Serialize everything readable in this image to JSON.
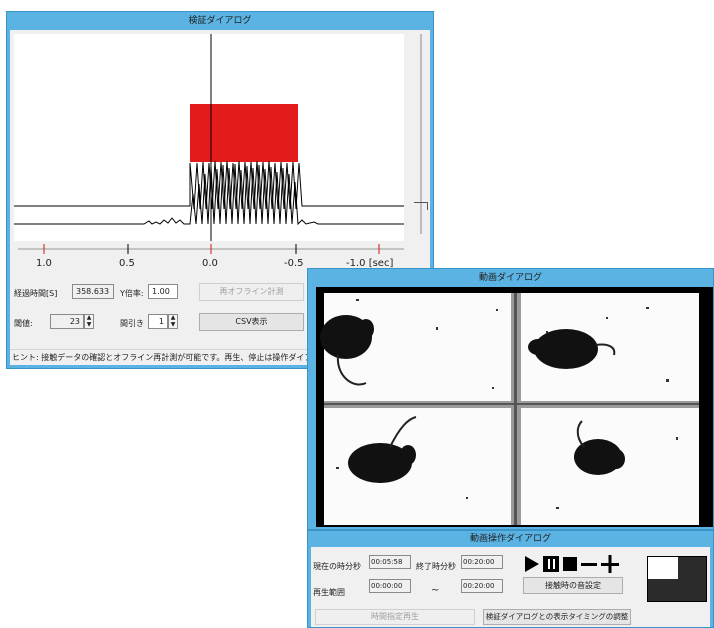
{
  "verify_dialog": {
    "title": "検証ダイアログ",
    "axis_ticks": [
      "1.0",
      "0.5",
      "0.0",
      "-0.5",
      "-1.0 [sec]"
    ],
    "elapsed_label": "経過時間[S]",
    "elapsed_value": "358.633",
    "ymag_label": "Y倍率:",
    "ymag_value": "1.00",
    "reoffline_button": "再オフライン計測",
    "threshold_label": "閾値:",
    "threshold_value": "23",
    "thinning_label": "間引き",
    "thinning_value": "1",
    "csv_button": "CSV表示",
    "hint": "ヒント:  接触データの確認とオフライン再計測が可能です。再生、停止は操作ダイアログか"
  },
  "video_dialog": {
    "title": "動画ダイアログ"
  },
  "operation_dialog": {
    "title": "動画操作ダイアログ",
    "current_time_label": "現在の時分秒",
    "current_time_value": "00:05:58",
    "end_time_label": "終了時分秒",
    "end_time_value": "00:20:00",
    "range_label": "再生範囲",
    "range_start": "00:00:00",
    "range_sep": "~",
    "range_end": "00:20:00",
    "touch_sound_button": "接触時の音設定",
    "time_play_button": "時間指定再生",
    "sync_button": "検証ダイアログとの表示タイミングの調整",
    "icons": [
      "play-icon",
      "pause-icon",
      "stop-icon",
      "minus-icon",
      "plus-icon"
    ]
  },
  "colors": {
    "titlebar": "#5ab3e3",
    "highlight": "#e31b1b",
    "tick_red": "#d11"
  }
}
